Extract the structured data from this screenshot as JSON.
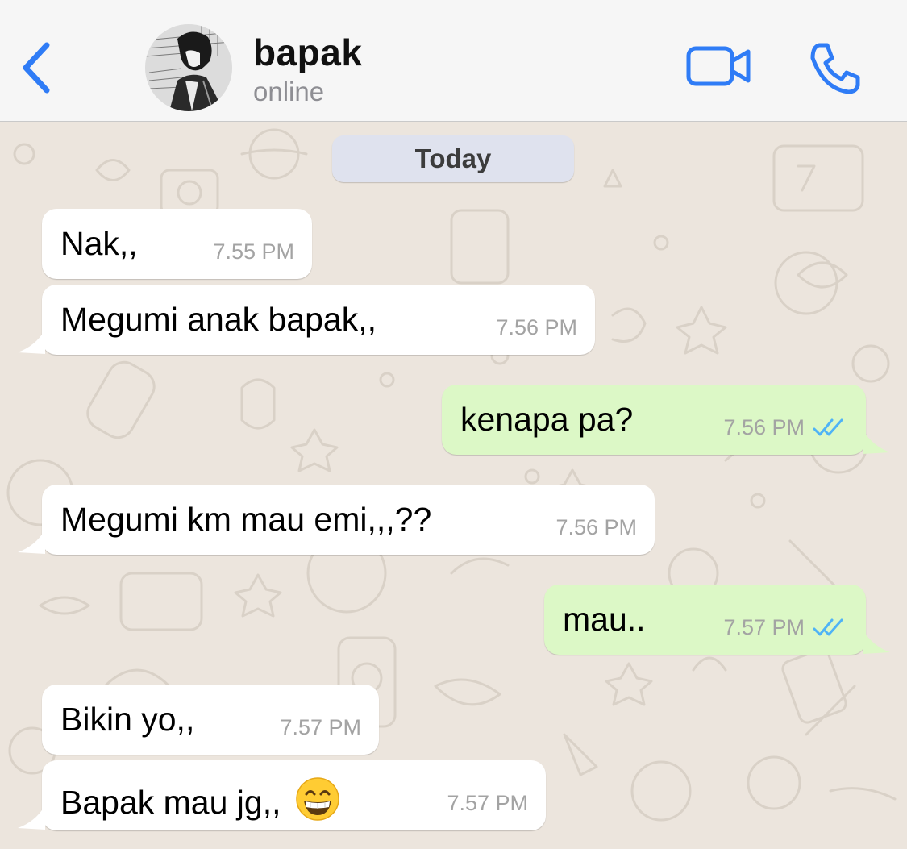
{
  "header": {
    "contact_name": "bapak",
    "contact_status": "online"
  },
  "chat": {
    "date_separator": "Today",
    "messages": [
      {
        "direction": "incoming",
        "text": "Nak,,",
        "time": "7.55 PM"
      },
      {
        "direction": "incoming",
        "text": "Megumi anak bapak,,",
        "time": "7.56 PM"
      },
      {
        "direction": "outgoing",
        "text": "kenapa pa?",
        "time": "7.56 PM",
        "status": "read"
      },
      {
        "direction": "incoming",
        "text": "Megumi km mau emi,,,??",
        "time": "7.56 PM"
      },
      {
        "direction": "outgoing",
        "text": "mau..",
        "time": "7.57 PM",
        "status": "read"
      },
      {
        "direction": "incoming",
        "text": "Bikin yo,,",
        "time": "7.57 PM"
      },
      {
        "direction": "incoming",
        "text": "Bapak mau jg,,",
        "time": "7.57 PM",
        "emoji": "grinning-face-with-smiling-eyes"
      }
    ]
  },
  "colors": {
    "accent": "#2f7cf6",
    "incoming_bubble": "#ffffff",
    "outgoing_bubble": "#dcf8c6",
    "read_tick": "#4fb3f6",
    "wallpaper": "#ece5dd",
    "date_pill": "#dfe2ee"
  },
  "icons": {
    "back": "chevron-left-icon",
    "video": "video-camera-icon",
    "call": "phone-icon",
    "read_receipt": "double-check-icon"
  }
}
